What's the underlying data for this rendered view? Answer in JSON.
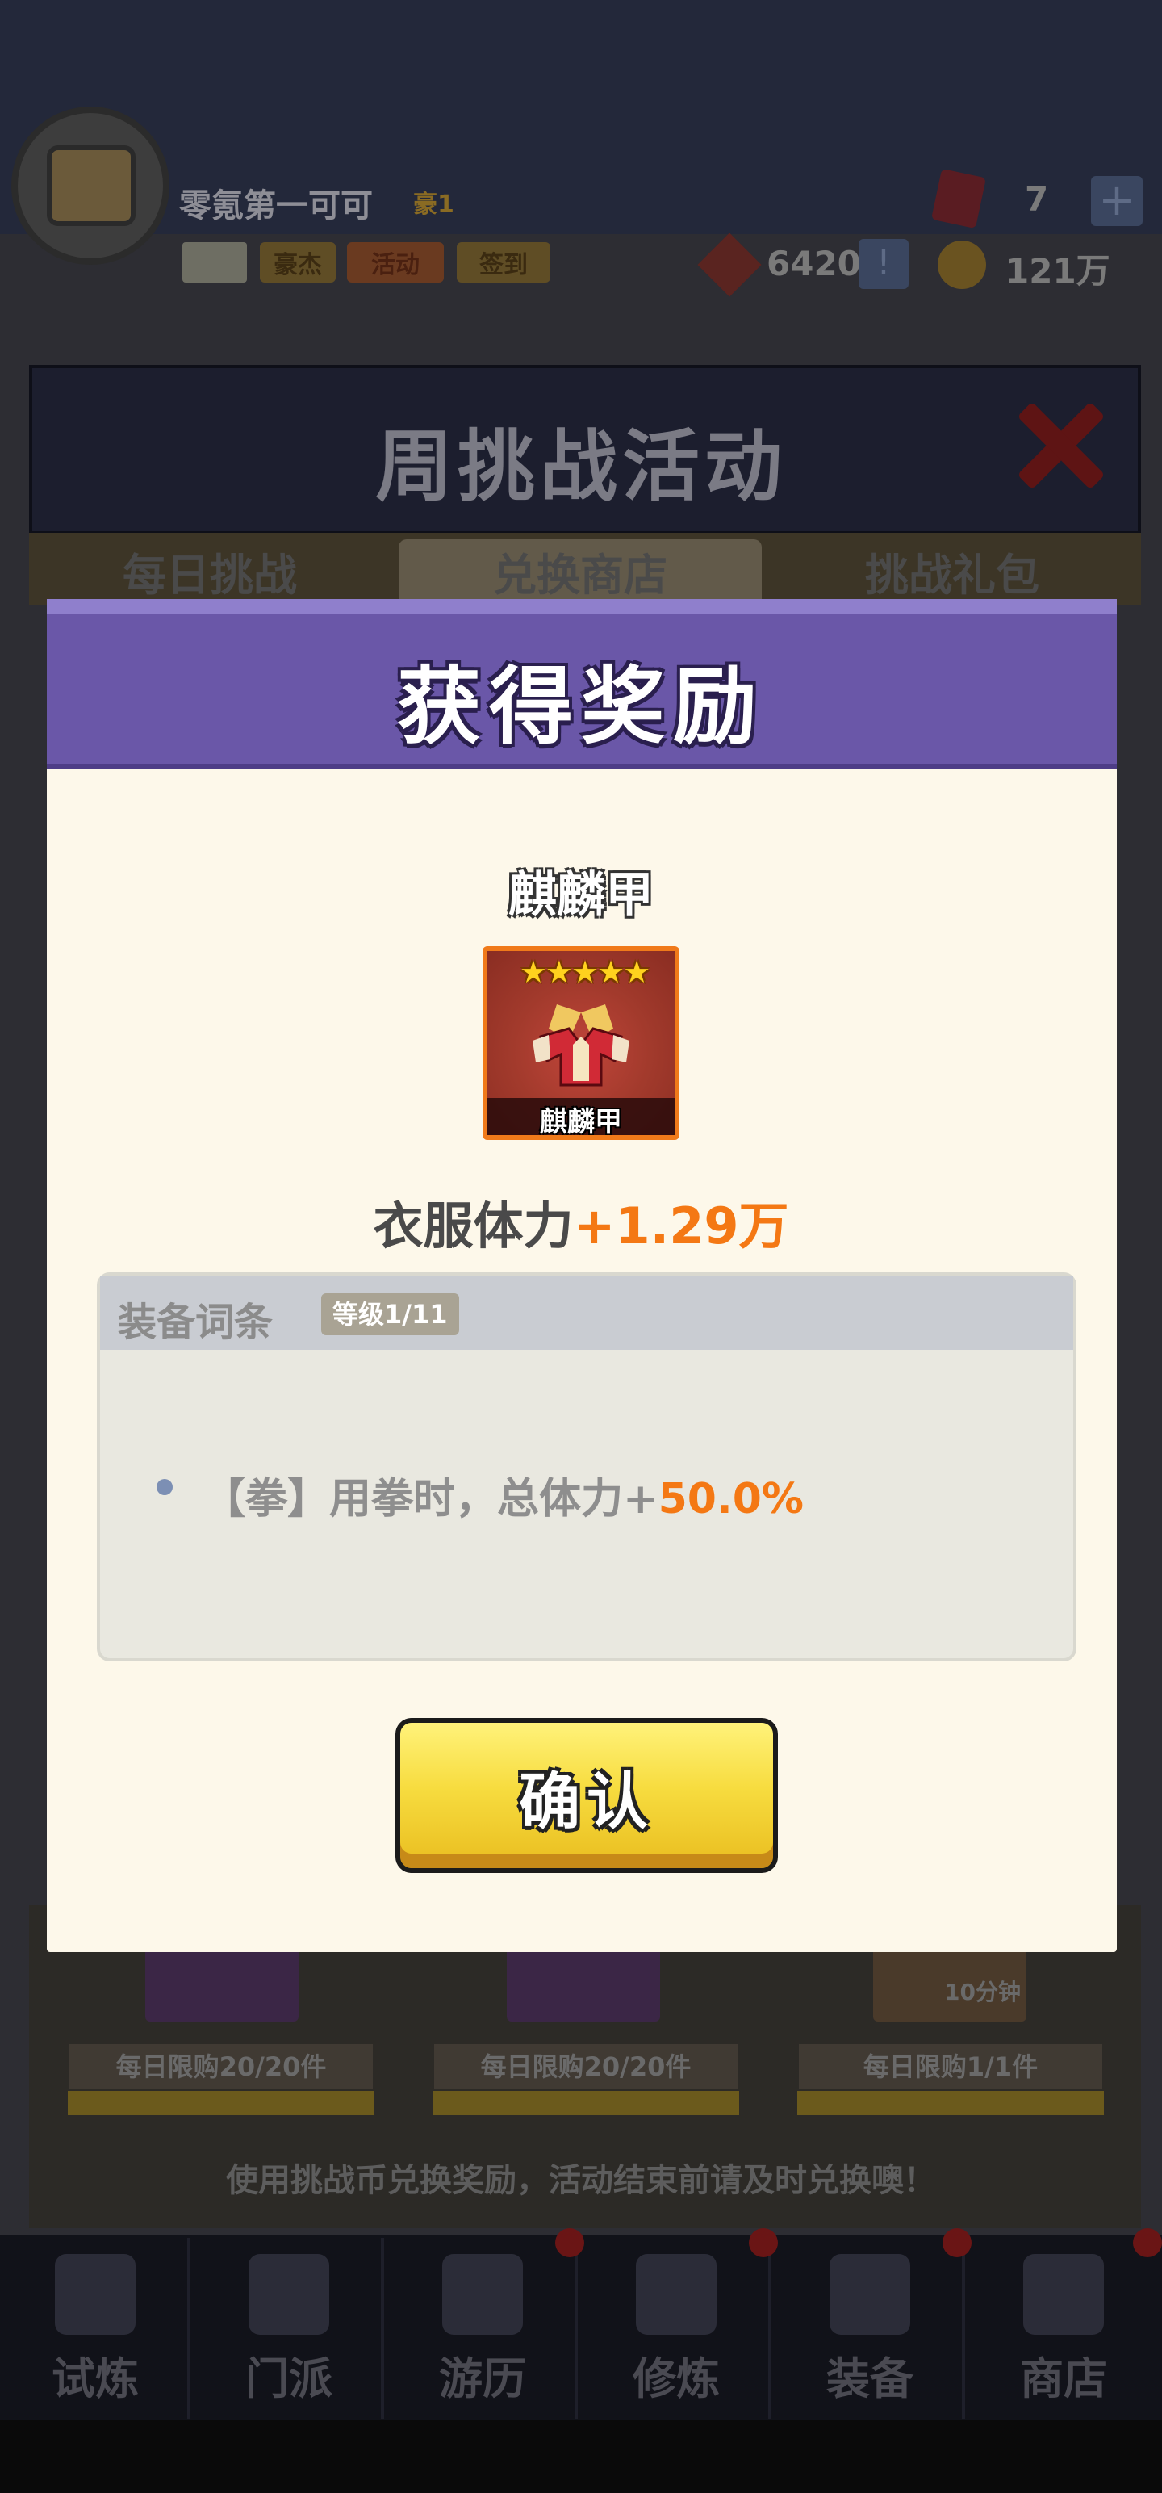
{
  "topbar": {
    "player_name": "零氪第一可可",
    "vip": "豪1",
    "tags": {
      "hero": "豪杰",
      "activity": "活动",
      "signin": "签到"
    },
    "gem_count": "7",
    "gem_plus": "+",
    "token_count": "6420",
    "token_bang": "!",
    "coin_count": "121万",
    "icons": [
      "avatar-chest-icon",
      "mail-icon",
      "gem-icon",
      "token-icon",
      "coin-icon"
    ]
  },
  "panel": {
    "title": "周挑战活动",
    "tabs": [
      "每日挑战",
      "兑换商店",
      "挑战礼包"
    ],
    "shop_limits": [
      "每日限购20/20件",
      "每日限购20/20件",
      "每日限购1/1件"
    ],
    "shop_timer": "10分钟",
    "shop_tip": "使用挑战币兑换奖励，活动结束前请及时兑换噢！"
  },
  "bottom_nav": [
    {
      "label": "试炼",
      "icon": "ninja-icon"
    },
    {
      "label": "门派",
      "icon": "temple-icon"
    },
    {
      "label": "游历",
      "icon": "mountain-icon"
    },
    {
      "label": "修炼",
      "icon": "scroll-icon"
    },
    {
      "label": "装备",
      "icon": "sword-icon"
    },
    {
      "label": "商店",
      "icon": "shop-icon"
    }
  ],
  "modal": {
    "title": "获得奖励",
    "item_name": "麒麟甲",
    "item_stars": "★★★★★",
    "item_caption": "麒麟甲",
    "stat_label": "衣服体力",
    "stat_value": "+1.29万",
    "affix_title": "装备词条",
    "affix_level": "等级1/11",
    "affix_desc": "【拳】用拳时，总体力+",
    "affix_value": "50.0%",
    "confirm": "确认"
  },
  "colors": {
    "modal_header": "#6a57a8",
    "modal_body": "#fdf8ea",
    "highlight_orange": "#f47814",
    "button_yellow": "#f7dc3f"
  }
}
